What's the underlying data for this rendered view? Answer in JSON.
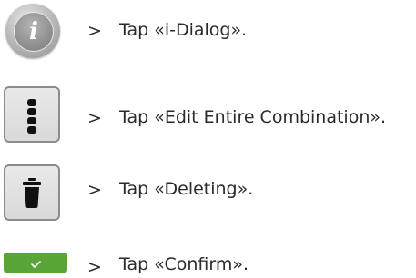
{
  "steps": [
    {
      "icon": "info-icon",
      "icon_glyph": "i",
      "arrow": ">",
      "text": "Tap «i-Dialog»."
    },
    {
      "icon": "vertical-dots-icon",
      "arrow": ">",
      "text": "Tap «Edit Entire Combination»."
    },
    {
      "icon": "trash-icon",
      "arrow": ">",
      "text": "Tap «Deleting»."
    },
    {
      "icon": "checkmark-icon",
      "arrow": ">",
      "text": "Tap «Confirm»."
    }
  ],
  "colors": {
    "confirm_green": "#5aa538",
    "button_border": "#8c8c8c",
    "icon_black": "#111111"
  }
}
